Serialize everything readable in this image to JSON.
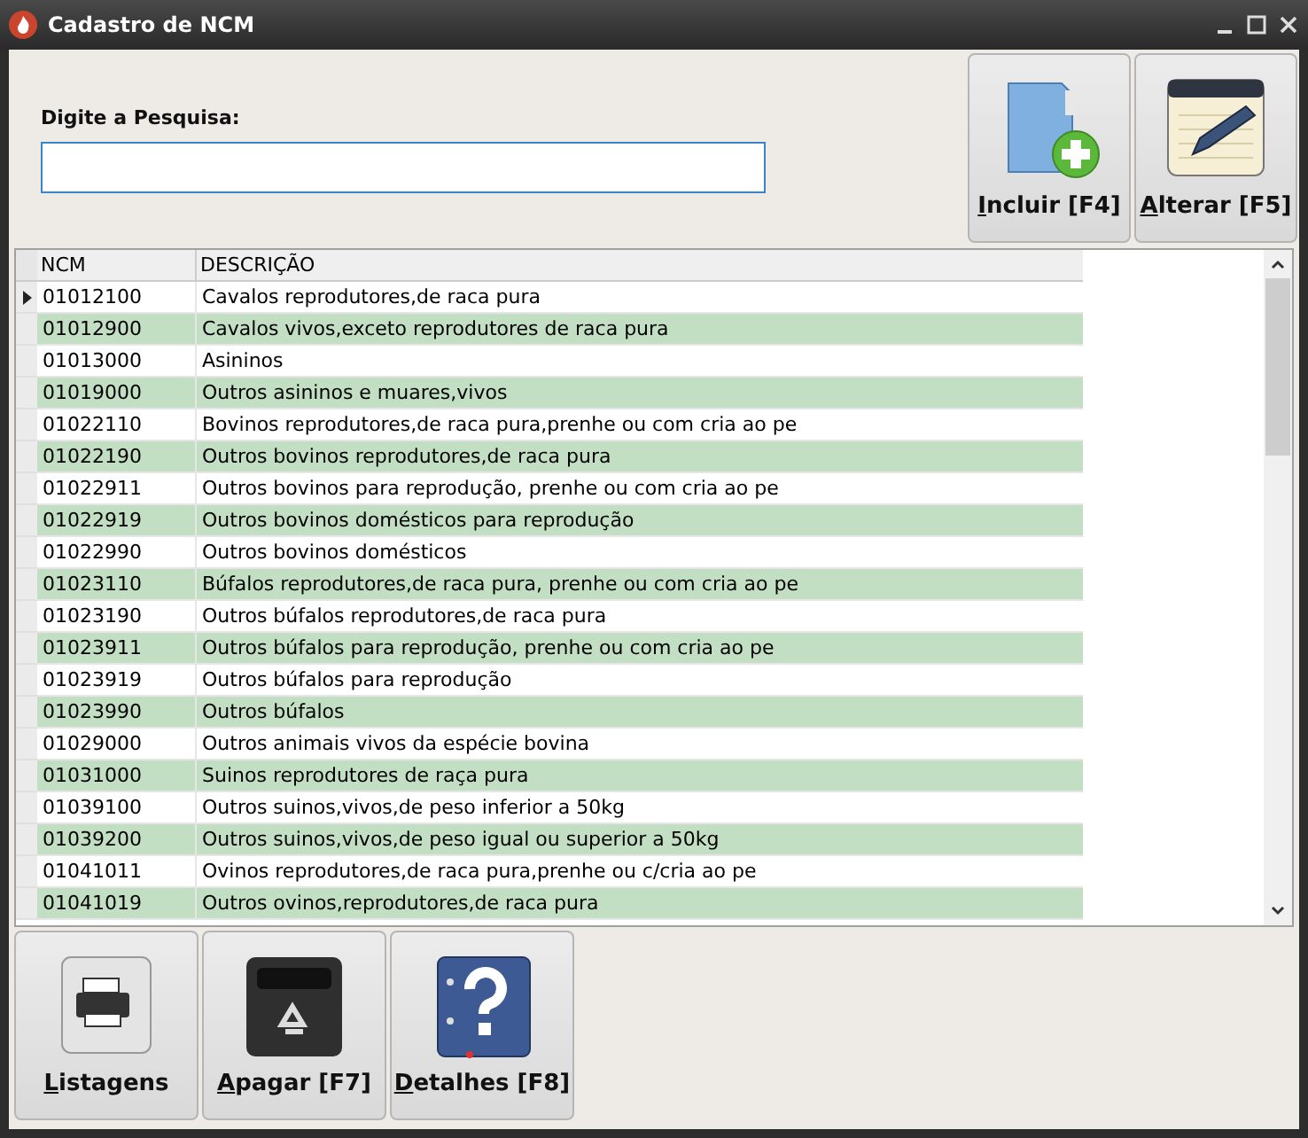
{
  "window": {
    "title": "Cadastro de NCM"
  },
  "search": {
    "label": "Digite a Pesquisa:"
  },
  "top_buttons": [
    {
      "kind": "add",
      "label": "Incluir [F4]"
    },
    {
      "kind": "edit",
      "label": "Alterar [F5]"
    }
  ],
  "table": {
    "columns": [
      "NCM",
      "DESCRIÇÃO"
    ],
    "rows": [
      {
        "ncm": "01012100",
        "desc": "Cavalos reprodutores,de raca pura",
        "selected": true
      },
      {
        "ncm": "01012900",
        "desc": "Cavalos vivos,exceto reprodutores de raca pura",
        "selected": false
      },
      {
        "ncm": "01013000",
        "desc": "Asininos",
        "selected": false
      },
      {
        "ncm": "01019000",
        "desc": "Outros asininos e muares,vivos",
        "selected": false
      },
      {
        "ncm": "01022110",
        "desc": "Bovinos reprodutores,de raca pura,prenhe ou com cria ao pe",
        "selected": false
      },
      {
        "ncm": "01022190",
        "desc": "Outros bovinos reprodutores,de raca pura",
        "selected": false
      },
      {
        "ncm": "01022911",
        "desc": "Outros bovinos para reprodução, prenhe ou com cria ao pe",
        "selected": false
      },
      {
        "ncm": "01022919",
        "desc": "Outros bovinos domésticos para reprodução",
        "selected": false
      },
      {
        "ncm": "01022990",
        "desc": "Outros bovinos domésticos",
        "selected": false
      },
      {
        "ncm": "01023110",
        "desc": "Búfalos reprodutores,de raca pura, prenhe ou com cria ao pe",
        "selected": false
      },
      {
        "ncm": "01023190",
        "desc": "Outros búfalos reprodutores,de raca pura",
        "selected": false
      },
      {
        "ncm": "01023911",
        "desc": "Outros búfalos para reprodução, prenhe ou com cria ao pe",
        "selected": false
      },
      {
        "ncm": "01023919",
        "desc": "Outros búfalos para reprodução",
        "selected": false
      },
      {
        "ncm": "01023990",
        "desc": "Outros búfalos",
        "selected": false
      },
      {
        "ncm": "01029000",
        "desc": "Outros animais vivos da espécie bovina",
        "selected": false
      },
      {
        "ncm": "01031000",
        "desc": "Suinos  reprodutores de raça pura",
        "selected": false
      },
      {
        "ncm": "01039100",
        "desc": "Outros suinos,vivos,de peso inferior a 50kg",
        "selected": false
      },
      {
        "ncm": "01039200",
        "desc": "Outros suinos,vivos,de peso igual ou superior a 50kg",
        "selected": false
      },
      {
        "ncm": "01041011",
        "desc": "Ovinos reprodutores,de raca pura,prenhe ou c/cria ao pe",
        "selected": false
      },
      {
        "ncm": "01041019",
        "desc": "Outros ovinos,reprodutores,de raca pura",
        "selected": false
      }
    ]
  },
  "bottom_buttons": [
    {
      "kind": "print",
      "label": "Listagens"
    },
    {
      "kind": "delete",
      "label": "Apagar [F7]"
    },
    {
      "kind": "help",
      "label": "Detalhes [F8]"
    }
  ]
}
